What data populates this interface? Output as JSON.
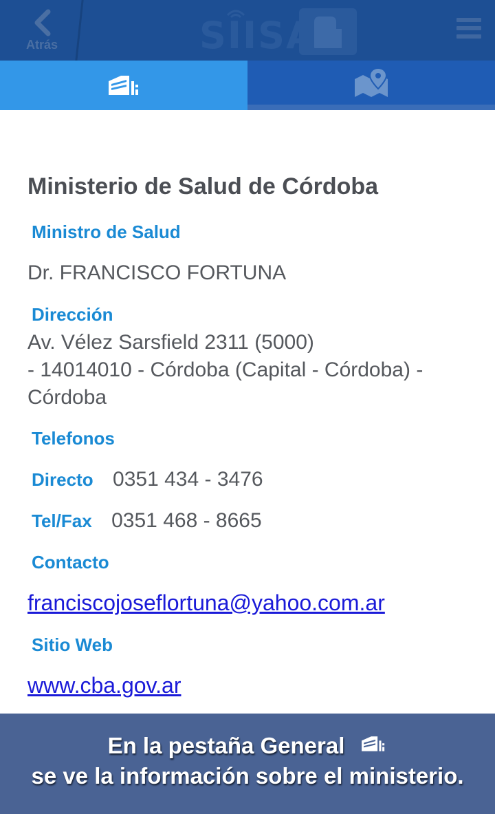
{
  "header": {
    "back_label": "Atrás",
    "logo_text": "SIISA",
    "back_icon": "chevron-left-icon",
    "menu_icon": "hamburger-menu-icon"
  },
  "tabs": [
    {
      "name": "general",
      "icon": "building-icon",
      "active": true
    },
    {
      "name": "map",
      "icon": "map-pin-icon",
      "active": false
    }
  ],
  "ministry": {
    "title": "Ministerio de Salud de Córdoba",
    "minister_label": "Ministro de Salud",
    "minister_value": "Dr. FRANCISCO FORTUNA",
    "address_label": "Dirección",
    "address_line1": "Av. Vélez Sarsfield 2311 (5000)",
    "address_line2": "- 14014010 - Córdoba (Capital - Córdoba) -",
    "address_line3": "Córdoba",
    "phones_label": "Telefonos",
    "direct_label": "Directo",
    "direct_value": "0351 434 - 3476",
    "telfax_label": "Tel/Fax",
    "telfax_value": "0351 468 - 8665",
    "contact_label": "Contacto",
    "contact_value": "franciscojoseflortuna@yahoo.com.ar",
    "web_label": "Sitio Web",
    "web_value": "www.cba.gov.ar"
  },
  "caption": {
    "line1": "En la pestaña General",
    "line2": "se ve la información sobre el ministerio."
  },
  "colors": {
    "header_bg": "#1d4f94",
    "tab_active": "#3397e8",
    "tab_inactive": "#1f5cb4",
    "label_blue": "#1a8ad4",
    "link_blue": "#1a1ad8",
    "caption_bg": "#4a6394"
  }
}
